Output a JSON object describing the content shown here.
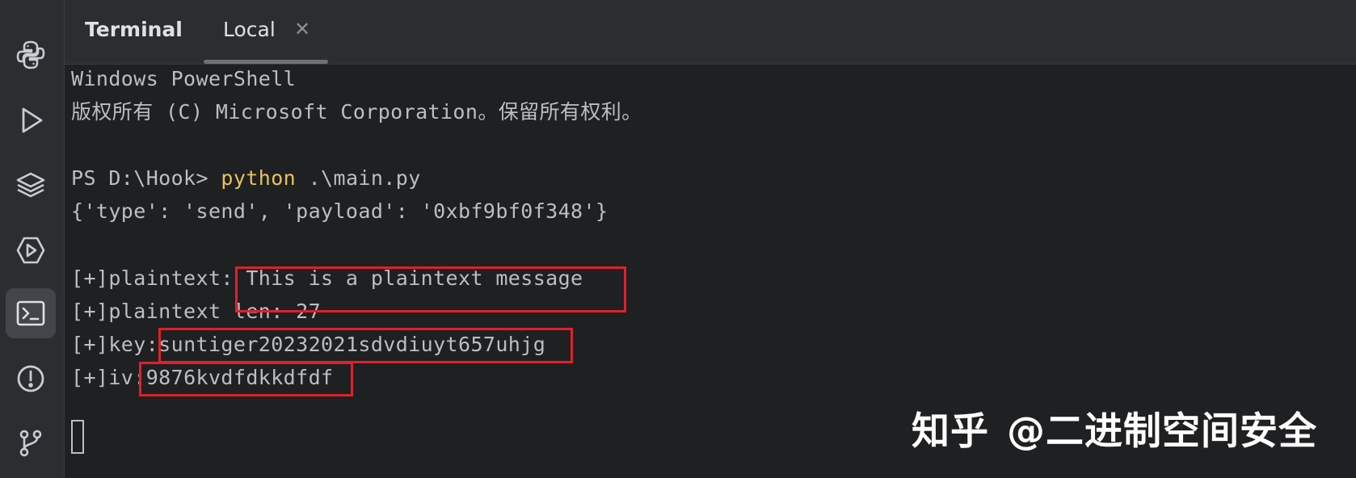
{
  "tabbar": {
    "title": "Terminal",
    "tabs": [
      {
        "label": "Local",
        "close": "✕"
      }
    ]
  },
  "toolstrip": {
    "tools": [
      {
        "icon": "python-icon"
      },
      {
        "icon": "run-icon"
      },
      {
        "icon": "layers-icon"
      },
      {
        "icon": "services-icon"
      },
      {
        "icon": "terminal-icon",
        "active": true
      },
      {
        "icon": "problems-icon"
      },
      {
        "icon": "git-icon"
      }
    ]
  },
  "terminal": {
    "line1": "Windows PowerShell",
    "line2": "版权所有 (C) Microsoft Corporation。保留所有权利。",
    "prompt": "PS D:\\Hook> ",
    "command": "python",
    "args": " .\\main.py",
    "line4": "{'type': 'send', 'payload': '0xbf9bf0f348'}",
    "plaintext_label": "[+]plaintext:",
    "plaintext_value": " This is a plaintext message",
    "plaintext_len": "[+]plaintext len: 27",
    "key_label": "[+]key:",
    "key_value": "suntiger20232021sdvdiuyt657uhjg",
    "iv_label": "[+]iv:",
    "iv_value": "9876kvdfdkkdfdf"
  },
  "watermark": {
    "logo": "知乎",
    "handle": "@二进制空间安全"
  },
  "colors": {
    "background": "#1f2022",
    "panel": "#2b2d30",
    "text": "#bcbec4",
    "command": "#e8c35a",
    "highlight": "#e0202a"
  }
}
